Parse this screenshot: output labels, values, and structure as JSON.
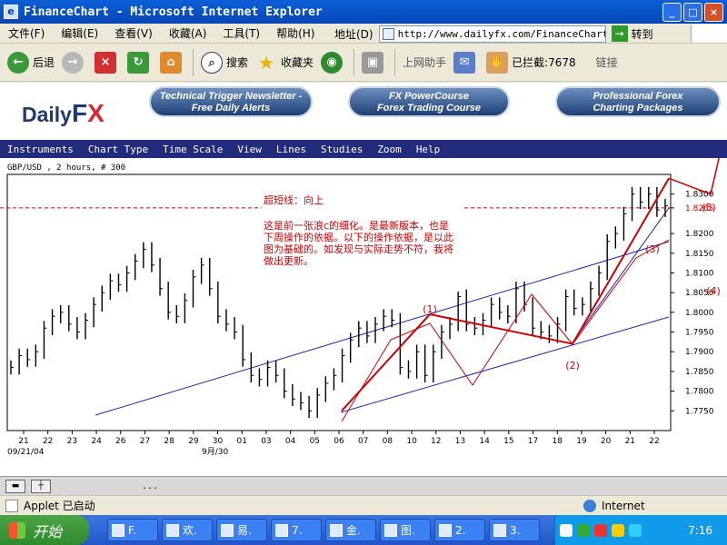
{
  "window": {
    "title": "FinanceChart - Microsoft Internet Explorer"
  },
  "menu": [
    "文件(F)",
    "编辑(E)",
    "查看(V)",
    "收藏(A)",
    "工具(T)",
    "帮助(H)"
  ],
  "address": {
    "label": "地址(D)",
    "url": "http://www.dailyfx.com/FinanceChart.",
    "go_label": "转到"
  },
  "toolbar": {
    "back": "后退",
    "search": "搜索",
    "favorites": "收藏夹",
    "assistant": "上网助手",
    "blocked": "已拦截:7678",
    "links": "链接"
  },
  "site": {
    "logo_main": "Daily",
    "logo_fx_f": "F",
    "logo_fx_x": "X",
    "banners": [
      {
        "line1": "Technical Trigger Newsletter -",
        "line2": "Free Daily Alerts"
      },
      {
        "line1": "FX PowerCourse",
        "line2": "Forex Trading Course"
      },
      {
        "line1": "Professional Forex",
        "line2": "Charting Packages"
      }
    ],
    "app_menu": [
      "Instruments",
      "Chart Type",
      "Time Scale",
      "View",
      "Lines",
      "Studies",
      "Zoom",
      "Help"
    ]
  },
  "chart_data": {
    "type": "line",
    "title": "GBP/USD , 2 hours, # 300",
    "ylim": [
      1.77,
      1.835
    ],
    "y_ticks": [
      "1.8300",
      "1.8265",
      "1.8200",
      "1.8150",
      "1.8100",
      "1.8050",
      "1.8000",
      "1.7950",
      "1.7900",
      "1.7850",
      "1.7800",
      "1.7750"
    ],
    "current_price": 1.8265,
    "x_ticks": [
      "21",
      "22",
      "23",
      "24",
      "26",
      "27",
      "28",
      "29",
      "30",
      "01",
      "03",
      "04",
      "05",
      "06",
      "07",
      "08",
      "10",
      "12",
      "13",
      "14",
      "15",
      "17",
      "18",
      "19",
      "20",
      "21",
      "22"
    ],
    "x_sublabels": [
      "09/21/04",
      "9月/30"
    ],
    "series": [
      {
        "values": [
          1.786,
          1.789,
          1.788,
          1.79,
          1.796,
          1.799,
          1.8,
          1.797,
          1.795,
          1.798,
          1.802,
          1.805,
          1.808,
          1.807,
          1.81,
          1.813,
          1.816,
          1.812,
          1.806,
          1.8,
          1.799,
          1.803,
          1.809,
          1.812,
          1.806,
          1.799,
          1.797,
          1.795,
          1.788,
          1.784,
          1.783,
          1.786,
          1.784,
          1.78,
          1.778,
          1.777,
          1.775,
          1.779,
          1.782,
          1.784,
          1.789,
          1.793,
          1.796,
          1.794,
          1.797,
          1.799,
          1.798,
          1.786,
          1.785,
          1.79,
          1.784,
          1.79,
          1.795,
          1.797,
          1.804,
          1.797,
          1.796,
          1.798,
          1.802,
          1.8,
          1.799,
          1.806,
          1.802,
          1.796,
          1.795,
          1.794,
          1.797,
          1.804,
          1.801,
          1.802,
          1.806,
          1.81,
          1.818,
          1.82,
          1.825,
          1.83,
          1.828,
          1.83,
          1.826,
          1.827
        ]
      }
    ],
    "wave_labels": [
      "(1)",
      "(2)",
      "(3)",
      "(4)",
      "(5)"
    ],
    "wave_points": [
      {
        "label": "start",
        "x": 0.0,
        "y": 1.775
      },
      {
        "label": "(1)",
        "x": 1.0,
        "y": 1.7995
      },
      {
        "label": "(2)",
        "x": 2.0,
        "y": 1.792
      },
      {
        "label": "(3)",
        "x": 3.0,
        "y": 1.834
      },
      {
        "label": "(4)",
        "x": 3.5,
        "y": 1.83
      },
      {
        "label": "(5)",
        "x": 4.0,
        "y": 1.846
      }
    ],
    "annotation": {
      "headline": "超短线：向上",
      "body": "这是前一张浪c的细化。是最新版本，也是下周操作的依据。以下的操作依据，是以此图为基础的。如发现与实际走势不符，我将做出更新。"
    },
    "colors": {
      "price": "#000000",
      "channel": "#2222aa",
      "wave": "#cc0000",
      "annotation": "#cc0000"
    }
  },
  "applet_bar": {
    "dots": "..."
  },
  "status": {
    "left": "Applet 已启动",
    "right": "Internet"
  },
  "taskbar": {
    "start": "开始",
    "tasks": [
      "F.",
      "欢.",
      "易.",
      "7.",
      "金.",
      "图.",
      "2.",
      "3."
    ],
    "clock": "7:16"
  }
}
